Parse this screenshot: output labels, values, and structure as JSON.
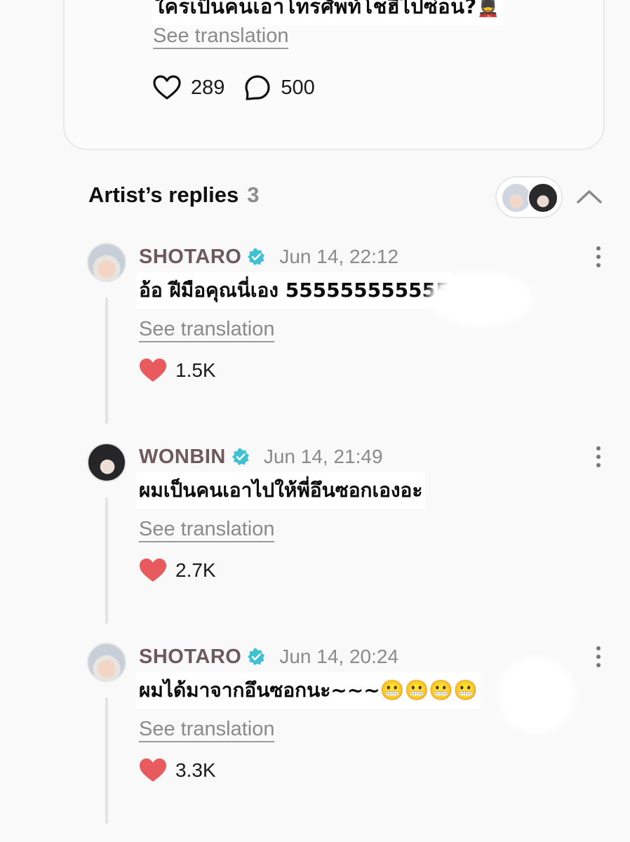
{
  "post": {
    "text": "ใครเป็นคนเอาโทรศัพท์โชฮีไปซ่อน?",
    "emoji": "💂",
    "see_translation": "See translation",
    "likes": "289",
    "comments": "500"
  },
  "replies_section": {
    "title": "Artist’s replies",
    "count": "3"
  },
  "replies": [
    {
      "author": "SHOTARO",
      "time": "Jun 14, 22:12",
      "text": "อ้อ ฝีมือคุณนี่เอง 555555555555",
      "see_translation": "See translation",
      "likes": "1.5K"
    },
    {
      "author": "WONBIN",
      "time": "Jun 14, 21:49",
      "text": "ผมเป็นคนเอาไปให้พี่อึนซอกเองอะ",
      "see_translation": "See translation",
      "likes": "2.7K"
    },
    {
      "author": "SHOTARO",
      "time": "Jun 14, 20:24",
      "text": "ผมได้มาจากอึนซอกนะ~~~",
      "emoji": "😬😬😬😬",
      "see_translation": "See translation",
      "likes": "3.3K"
    }
  ],
  "icons": {
    "like": "heart-outline-icon",
    "comment": "speech-bubble-icon",
    "liked": "heart-filled-icon",
    "verified": "verified-badge-icon",
    "collapse": "chevron-up-icon",
    "more": "more-vertical-icon"
  },
  "colors": {
    "heart": "#e85a5d",
    "verified": "#3ec1d3",
    "author": "#6e5a5e",
    "muted": "#8a8a8a"
  }
}
